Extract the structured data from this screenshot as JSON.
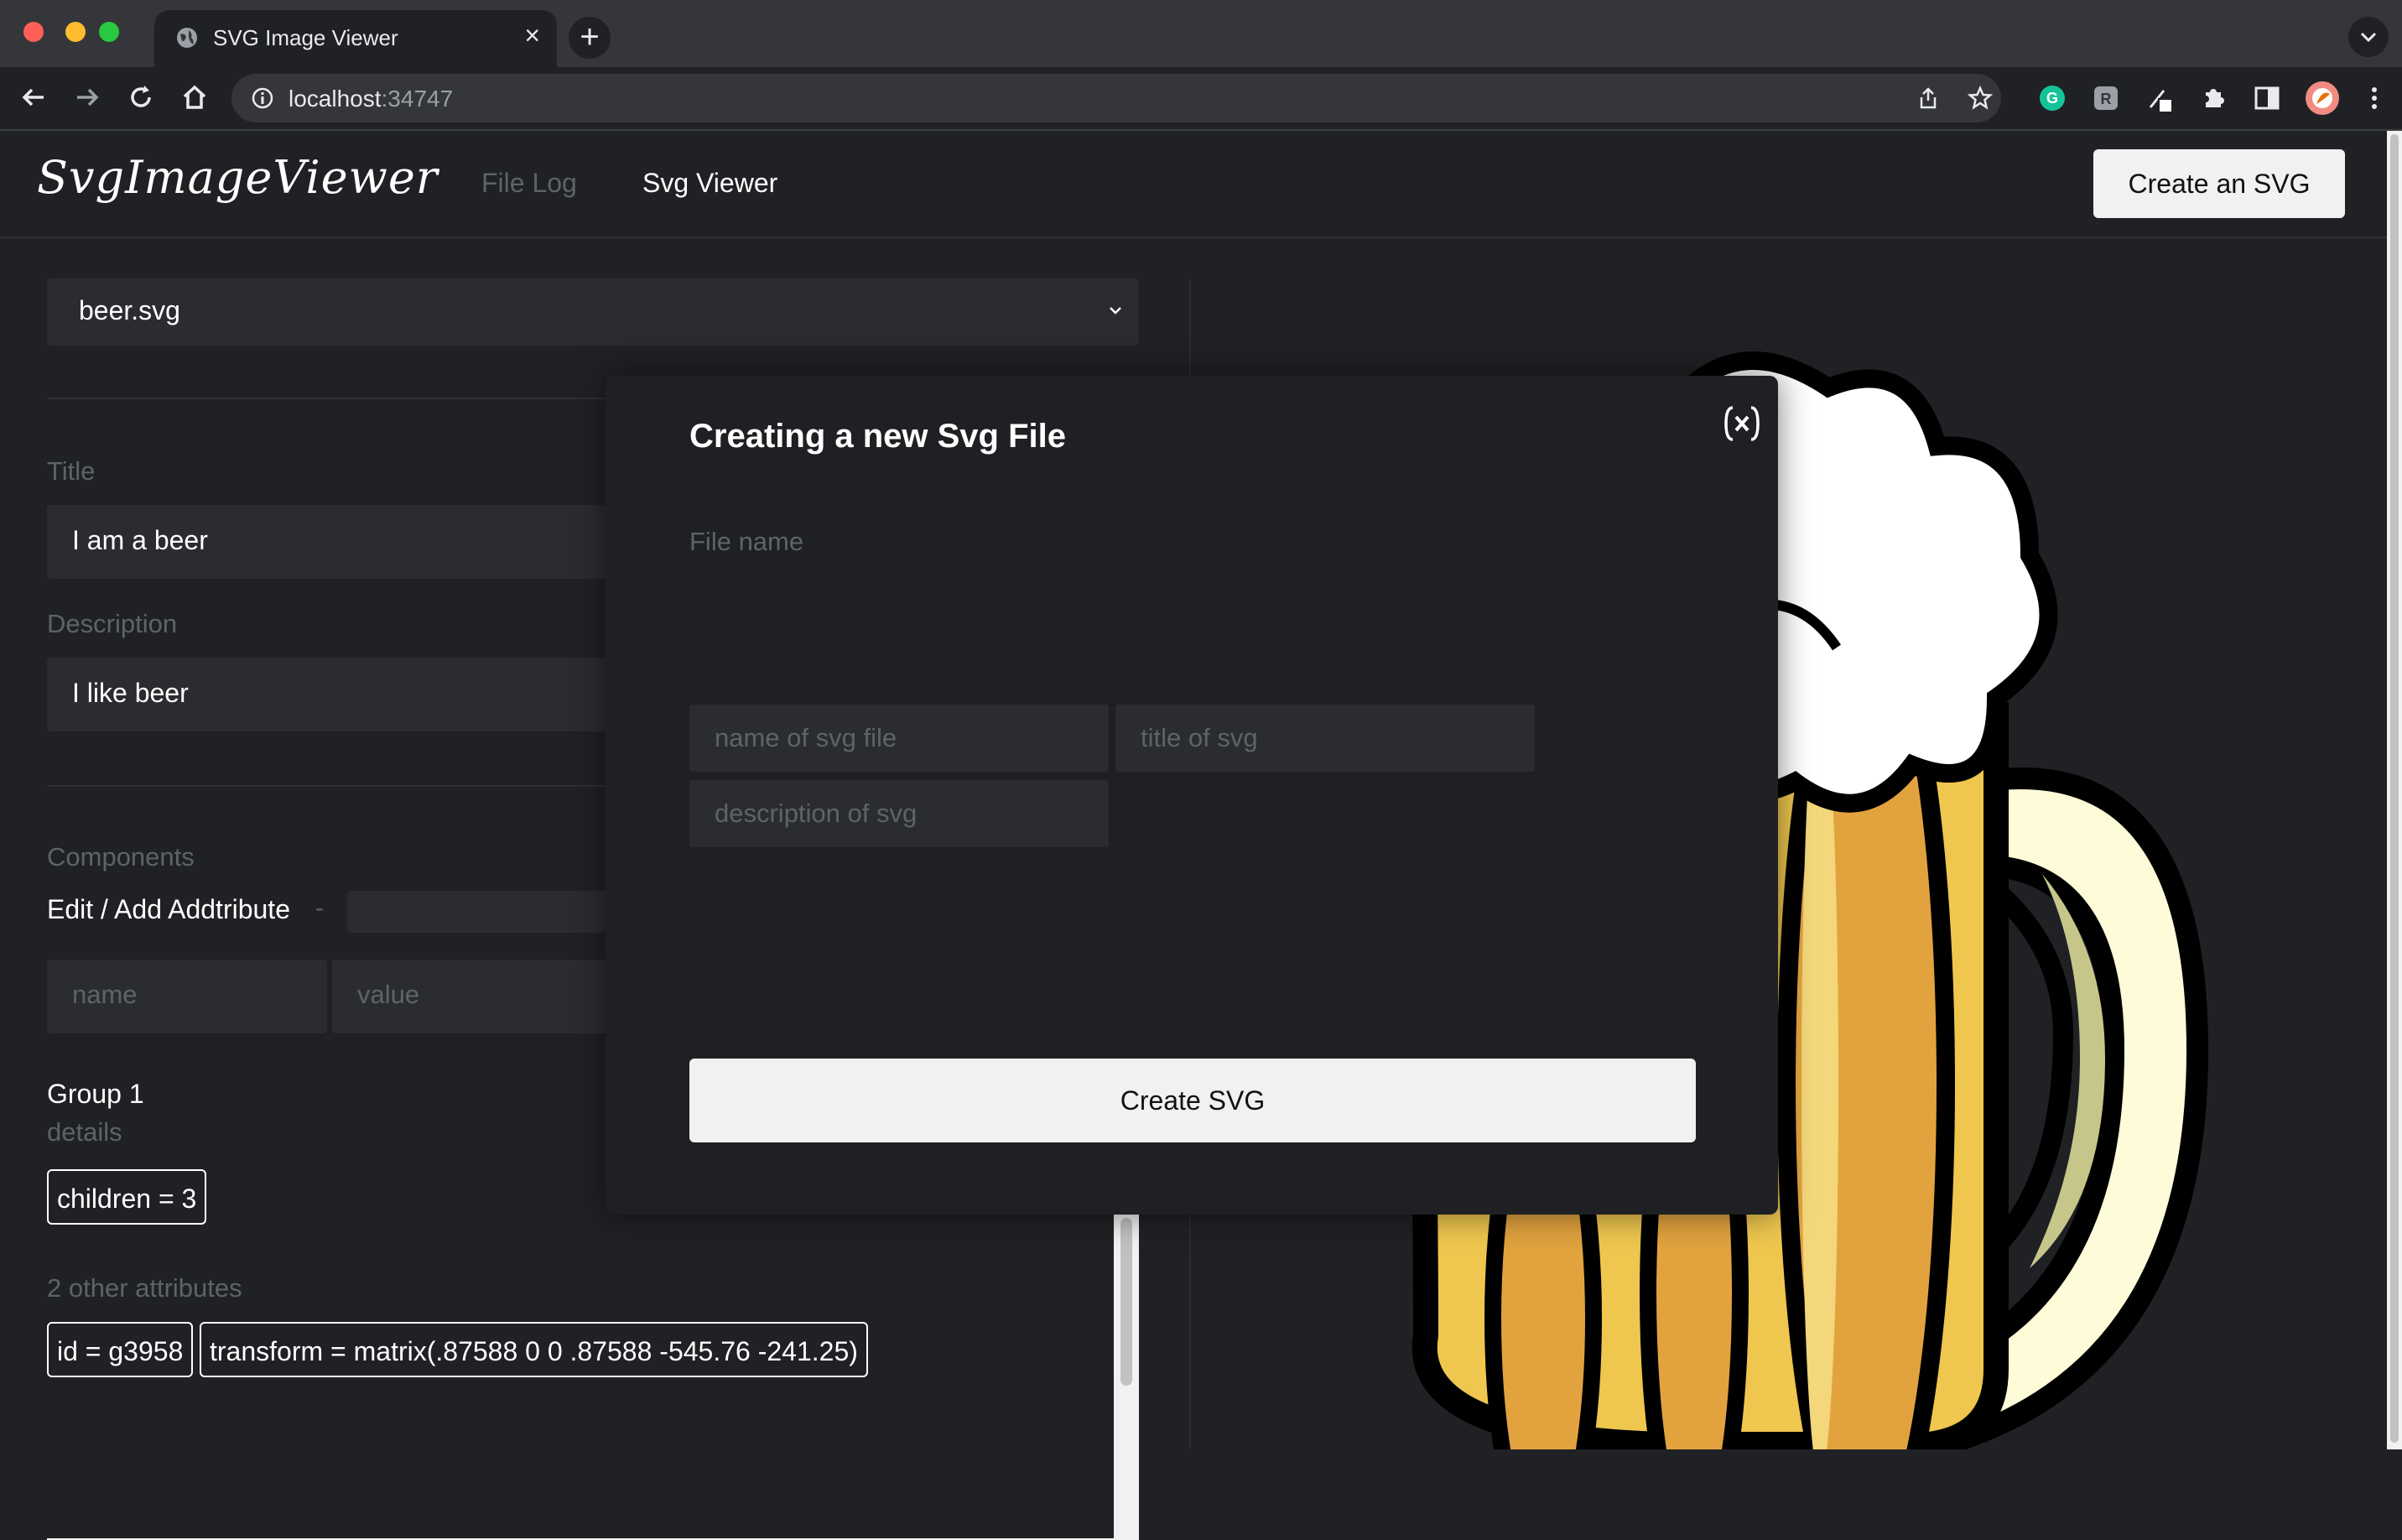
{
  "browser": {
    "tab_title": "SVG Image Viewer",
    "url_host": "localhost",
    "url_port": ":34747"
  },
  "navbar": {
    "logo": "SvgImageViewer",
    "links": [
      "File Log",
      "Svg Viewer"
    ],
    "active_link": "Svg Viewer",
    "create_button": "Create an SVG"
  },
  "viewer": {
    "file_select": "beer.svg",
    "title_label": "Title",
    "title_value": "I am a beer",
    "description_label": "Description",
    "description_value": "I like beer",
    "components_label": "Components",
    "edit_add_label": "Edit / Add Addtribute",
    "edit_dash": "-",
    "attr_name_placeholder": "name",
    "attr_value_placeholder": "value",
    "group_title": "Group 1",
    "group_details": "details",
    "children_chip": "children = 3",
    "other_attributes": "2 other attributes",
    "attributes": [
      "id = g3958",
      "transform = matrix(.87588 0 0 .87588 -545.76 -241.25)"
    ]
  },
  "modal": {
    "title": "Creating a new Svg File",
    "file_name_label": "File name",
    "name_placeholder": "name of svg file",
    "title_placeholder": "title of svg",
    "description_placeholder": "description of svg",
    "create_button": "Create SVG"
  },
  "colors": {
    "beer": "#efc74f",
    "beer_dark": "#e2a33e",
    "foam": "#ffffff",
    "handle": "#fefbd8",
    "outline": "#000000"
  }
}
